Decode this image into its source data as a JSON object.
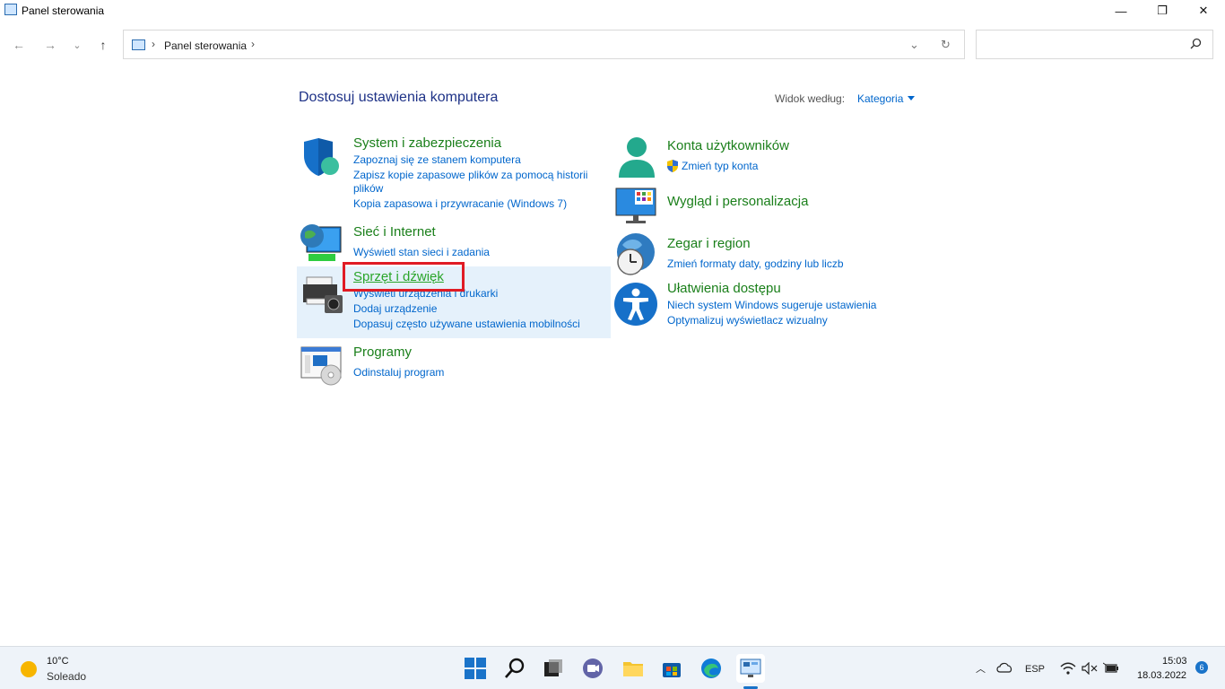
{
  "window": {
    "title": "Panel sterowania",
    "minimize": "—",
    "maximize": "❐",
    "close": "✕"
  },
  "nav": {
    "back": "←",
    "forward": "→",
    "recent": "⌄",
    "up": "↑"
  },
  "address": {
    "separator": "›",
    "path": "Panel sterowania",
    "trailing_separator": "›",
    "dropdown": "⌄",
    "refresh": "↻"
  },
  "search": {
    "placeholder": "",
    "icon": "search-icon"
  },
  "heading": "Dostosuj ustawienia komputera",
  "view_by": {
    "label": "Widok według:",
    "value": "Kategoria"
  },
  "categories_left": [
    {
      "title": "System i zabezpieczenia",
      "icon": "shield-icon",
      "links": [
        "Zapoznaj się ze stanem komputera",
        "Zapisz kopie zapasowe plików za pomocą historii",
        "plików",
        "Kopia zapasowa i przywracanie (Windows 7)"
      ]
    },
    {
      "title": "Sieć i Internet",
      "icon": "network-globe-icon",
      "links": [
        "Wyświetl stan sieci i zadania"
      ]
    },
    {
      "title": "Sprzęt i dźwięk",
      "icon": "printer-icon",
      "links": [
        "Wyświetl urządzenia i drukarki",
        "Dodaj urządzenie",
        "Dopasuj często używane ustawienia mobilności"
      ]
    },
    {
      "title": "Programy",
      "icon": "programs-icon",
      "links": [
        "Odinstaluj program"
      ]
    }
  ],
  "categories_right": [
    {
      "title": "Konta użytkowników",
      "icon": "user-icon",
      "links": [
        "Zmień typ konta"
      ]
    },
    {
      "title": "Wygląd i personalizacja",
      "icon": "monitor-icon",
      "links": []
    },
    {
      "title": "Zegar i region",
      "icon": "clock-globe-icon",
      "links": [
        "Zmień formaty daty, godziny lub liczb"
      ]
    },
    {
      "title": "Ułatwienia dostępu",
      "icon": "accessibility-icon",
      "links": [
        "Niech system Windows sugeruje ustawienia",
        "Optymalizuj wyświetlacz wizualny"
      ]
    }
  ],
  "taskbar": {
    "weather": {
      "temp": "10°C",
      "status": "Soleado"
    },
    "tray": {
      "lang": "ESP",
      "time": "15:03",
      "date": "18.03.2022",
      "notifications": "6"
    }
  },
  "colors": {
    "heading": "#1e3287",
    "category_title": "#1a7f1a",
    "link": "#0066cc",
    "highlight": "#e5f1fb",
    "redbox": "#e01b24"
  }
}
